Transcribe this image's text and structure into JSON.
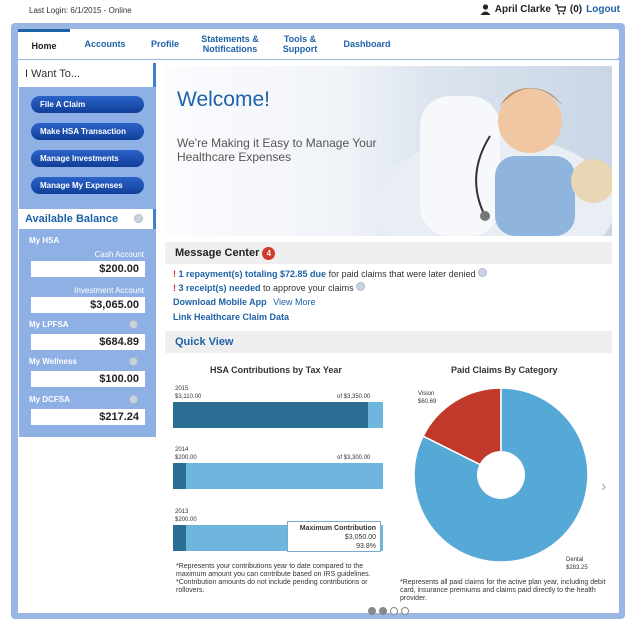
{
  "topbar": {
    "last_login": "Last Login: 6/1/2015 - Online",
    "user_name": "April Clarke",
    "cart": "(0)",
    "logout": "Logout"
  },
  "nav": {
    "tabs": [
      {
        "label": "Home"
      },
      {
        "label": "Accounts"
      },
      {
        "label": "Profile"
      },
      {
        "label": "Statements & Notifications"
      },
      {
        "label": "Tools & Support"
      },
      {
        "label": "Dashboard"
      }
    ]
  },
  "sidebar": {
    "i_want_to": "I Want To...",
    "buttons": [
      "File A Claim",
      "Make HSA Transaction",
      "Manage Investments",
      "Manage My Expenses"
    ],
    "available_balance": "Available Balance",
    "accounts": {
      "hsa_label": "My HSA",
      "cash_label": "Cash Account",
      "cash_value": "$200.00",
      "investment_label": "Investment Account",
      "investment_value": "$3,065.00",
      "lpfsa_label": "My LPFSA",
      "lpfsa_value": "$684.89",
      "wellness_label": "My Wellness",
      "wellness_value": "$100.00",
      "dcfsa_label": "My DCFSA",
      "dcfsa_value": "$217.24"
    }
  },
  "hero": {
    "title": "Welcome!",
    "subtitle": "We're Making it Easy to Manage Your Healthcare Expenses"
  },
  "messages": {
    "title": "Message Center",
    "count": "4",
    "line1_bold": "1 repayment(s) totaling $72.85 due",
    "line1_rest": " for paid claims that were later denied",
    "line2_bold": "3 receipt(s) needed",
    "line2_rest": " to approve your claims",
    "download": "Download Mobile App",
    "view_more": "View More",
    "link_data": "Link Healthcare Claim Data"
  },
  "quick_view": {
    "title": "Quick View"
  },
  "hsa_chart": {
    "title": "HSA Contributions by Tax Year",
    "bars": [
      {
        "year": "2015",
        "amount_label": "$3,110.00",
        "max_label": "of $3,350.00",
        "value": 3110,
        "max": 3350
      },
      {
        "year": "2014",
        "amount_label": "$200.00",
        "max_label": "of $3,300.00",
        "value": 200,
        "max": 3300
      },
      {
        "year": "2013",
        "amount_label": "$200.00",
        "max_label": "",
        "value": 200,
        "max": 3250
      }
    ],
    "tooltip_title": "Maximum Contribution",
    "tooltip_value": "$3,050.00",
    "tooltip_pct": "93.8%",
    "footnote1": "*Represents your contributions year to date compared to the maximum amount you can contribute based on IRS guidelines.",
    "footnote2": "*Contribution amounts do not include pending contributions or rollovers."
  },
  "chart_data": {
    "type": "pie",
    "title": "Paid Claims By Category",
    "categories": [
      "Vision",
      "Dental"
    ],
    "values": [
      60.69,
      283.25
    ],
    "labels": [
      "$60.69",
      "$283.25"
    ],
    "colors": [
      "#c0392b",
      "#56a8d6"
    ],
    "footnote": "*Represents all paid claims for the active plan year, including debit card, insurance premiums and claims paid directly to the health provider."
  },
  "carousel": {
    "active": 1,
    "total": 4
  }
}
